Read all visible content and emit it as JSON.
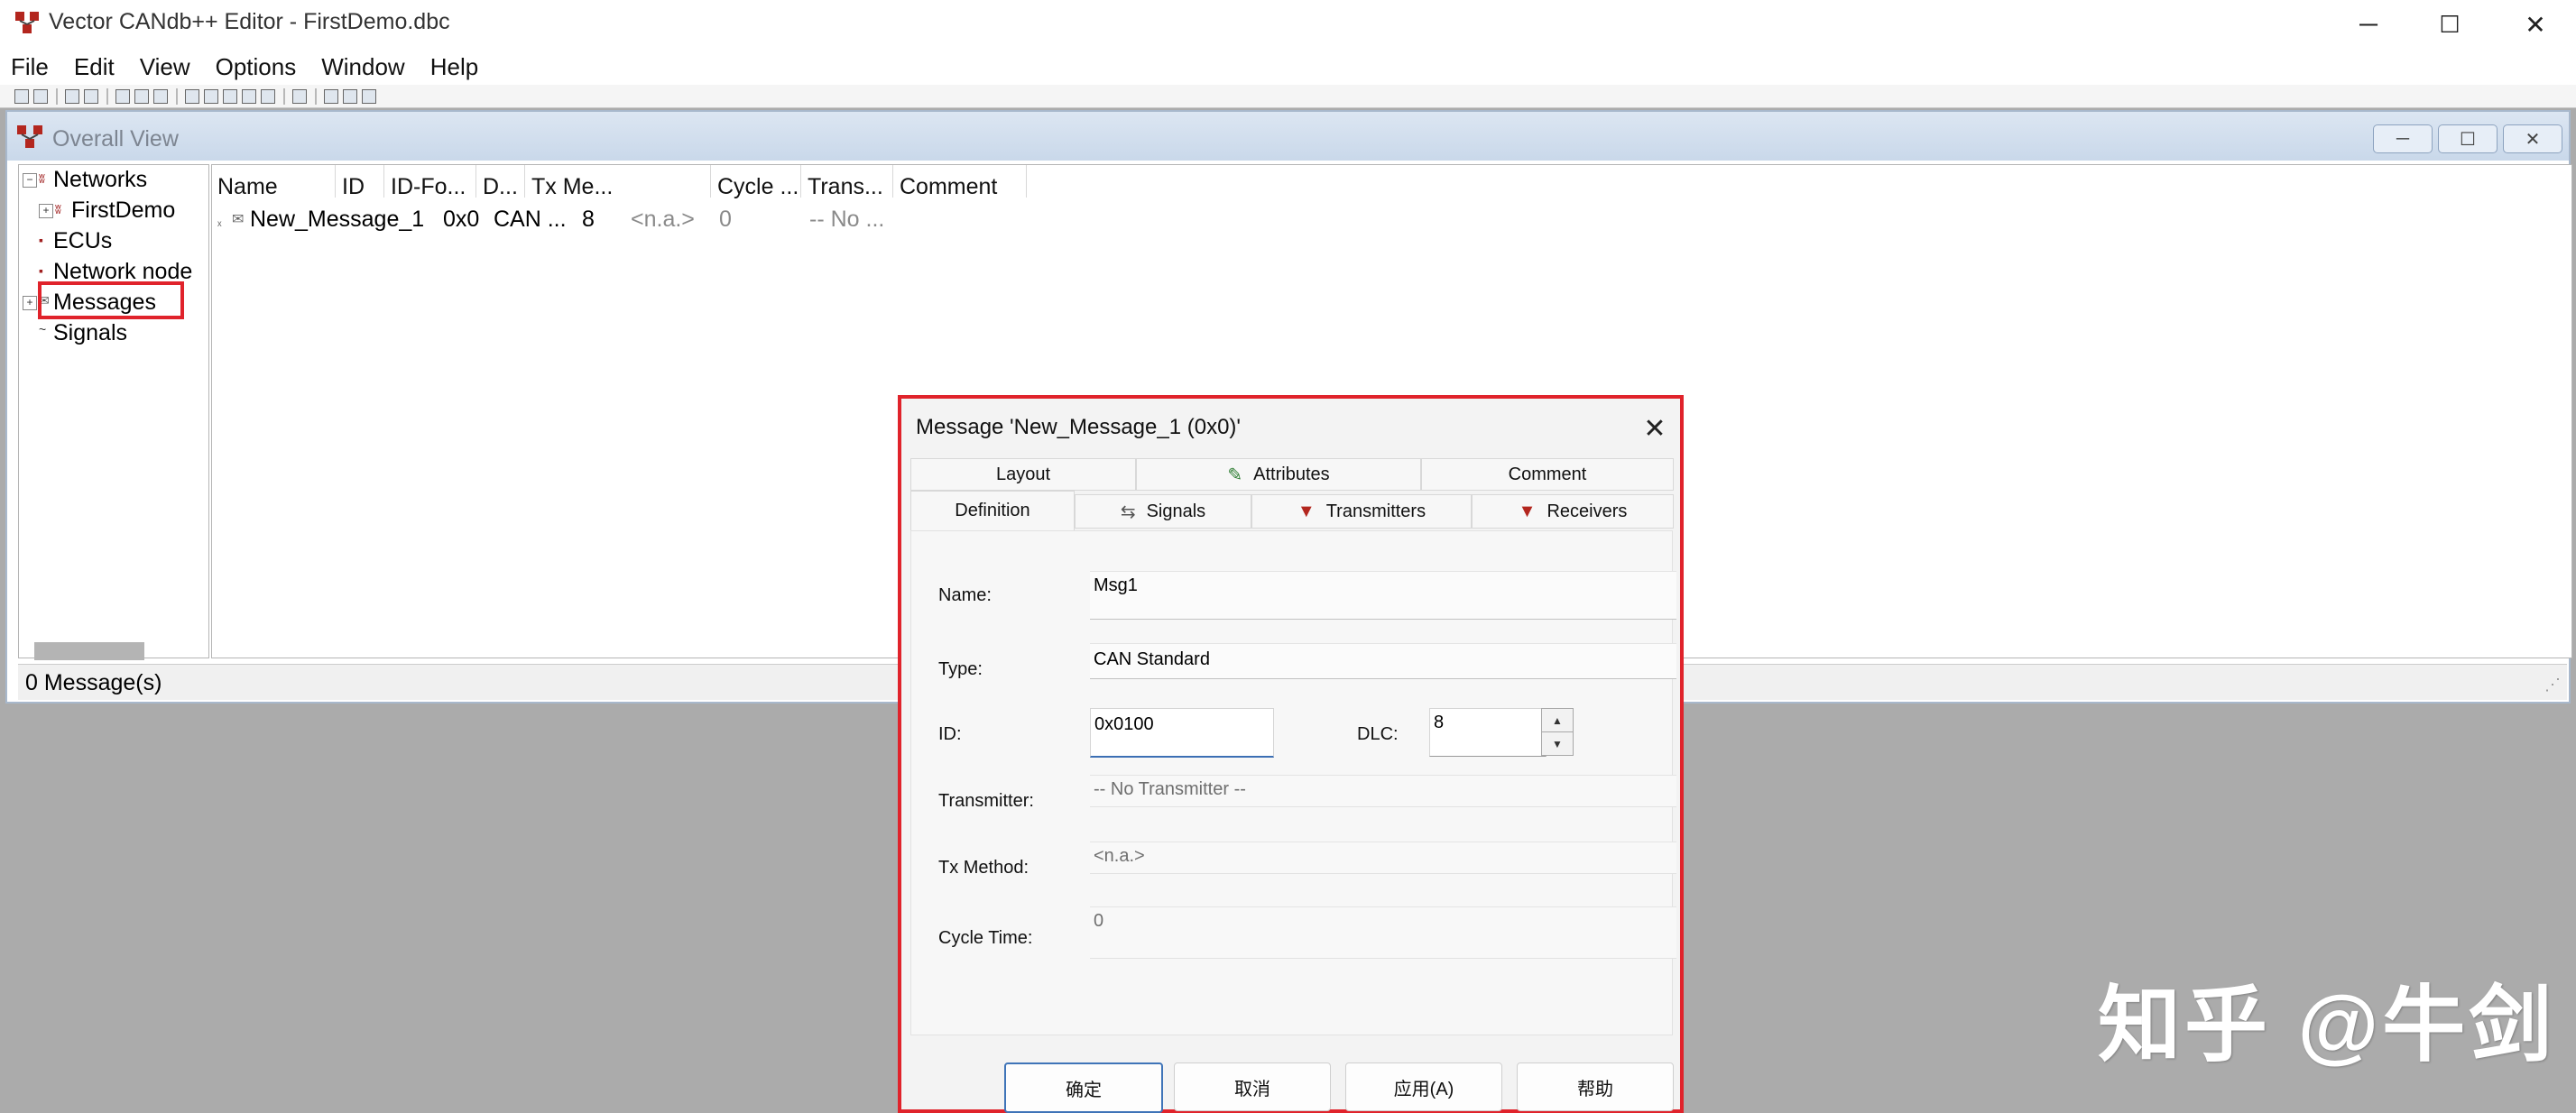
{
  "app": {
    "title": "Vector CANdb++ Editor - FirstDemo.dbc",
    "controls": {
      "minimize": "─",
      "maximize": "☐",
      "close": "✕"
    }
  },
  "menu": [
    "File",
    "Edit",
    "View",
    "Options",
    "Window",
    "Help"
  ],
  "overall_view": {
    "title": "Overall View",
    "tree": {
      "root": "Networks",
      "network": "FirstDemo",
      "ecus": "ECUs",
      "network_nodes": "Network node",
      "messages": "Messages",
      "signals": "Signals"
    },
    "columns": [
      "Name",
      "ID",
      "ID-Fo...",
      "D...",
      "Tx Me...",
      "Cycle ...",
      "Trans...",
      "Comment"
    ],
    "row": {
      "name": "New_Message_1",
      "id": "0x0",
      "id_format": "CAN ...",
      "dlc": "8",
      "tx_method": "<n.a.>",
      "cycle": "0",
      "transmitter": "-- No ..."
    },
    "status": "0 Message(s)"
  },
  "dialog": {
    "title": "Message 'New_Message_1 (0x0)'",
    "tabs_top": [
      "Layout",
      "Attributes",
      "Comment"
    ],
    "tabs_bottom": [
      "Definition",
      "Signals",
      "Transmitters",
      "Receivers"
    ],
    "labels": {
      "name": "Name:",
      "type": "Type:",
      "id": "ID:",
      "dlc": "DLC:",
      "transmitter": "Transmitter:",
      "tx_method": "Tx Method:",
      "cycle_time": "Cycle Time:"
    },
    "values": {
      "name": "Msg1",
      "type": "CAN Standard",
      "id": "0x0100",
      "dlc": "8",
      "transmitter": "-- No Transmitter --",
      "tx_method": "<n.a.>",
      "cycle_time": "0"
    },
    "buttons": [
      "确定",
      "取消",
      "应用(A)",
      "帮助"
    ]
  },
  "watermark": "知乎 @牛剑",
  "colors": {
    "highlight": "#e0232b",
    "titlebar_blue": "#c9d8ea",
    "mdi_background": "#ababab"
  }
}
